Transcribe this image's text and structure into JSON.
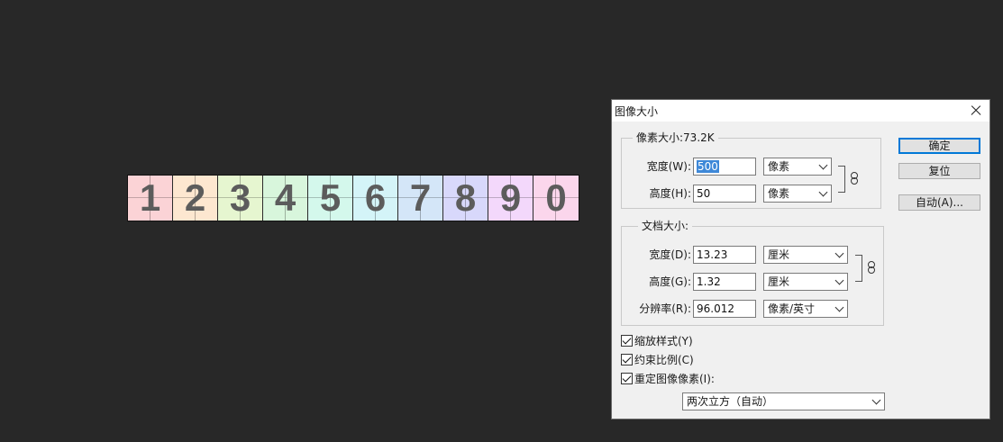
{
  "canvas": {
    "digits": [
      "1",
      "2",
      "3",
      "4",
      "5",
      "6",
      "7",
      "8",
      "9",
      "0"
    ],
    "tile_colors": [
      "#fbd3d6",
      "#fde7d0",
      "#e6f6d0",
      "#d8f6dc",
      "#d4f8ec",
      "#d4f4f8",
      "#d4e6f8",
      "#d8d8fb",
      "#f3d8fb",
      "#fbd6ec"
    ]
  },
  "dialog": {
    "title": "图像大小",
    "pixel_size": {
      "legend": "像素大小:73.2K",
      "width_label": "宽度(W):",
      "width_value": "500",
      "width_unit": "像素",
      "height_label": "高度(H):",
      "height_value": "50",
      "height_unit": "像素"
    },
    "document_size": {
      "legend": "文档大小:",
      "width_label": "宽度(D):",
      "width_value": "13.23",
      "width_unit": "厘米",
      "height_label": "高度(G):",
      "height_value": "1.32",
      "height_unit": "厘米",
      "resolution_label": "分辨率(R):",
      "resolution_value": "96.012",
      "resolution_unit": "像素/英寸"
    },
    "options": {
      "scale_styles": "缩放样式(Y)",
      "constrain_proportions": "约束比例(C)",
      "resample": "重定图像像素(I):",
      "resample_method": "两次立方（自动）"
    },
    "buttons": {
      "ok": "确定",
      "reset": "复位",
      "auto": "自动(A)..."
    }
  }
}
